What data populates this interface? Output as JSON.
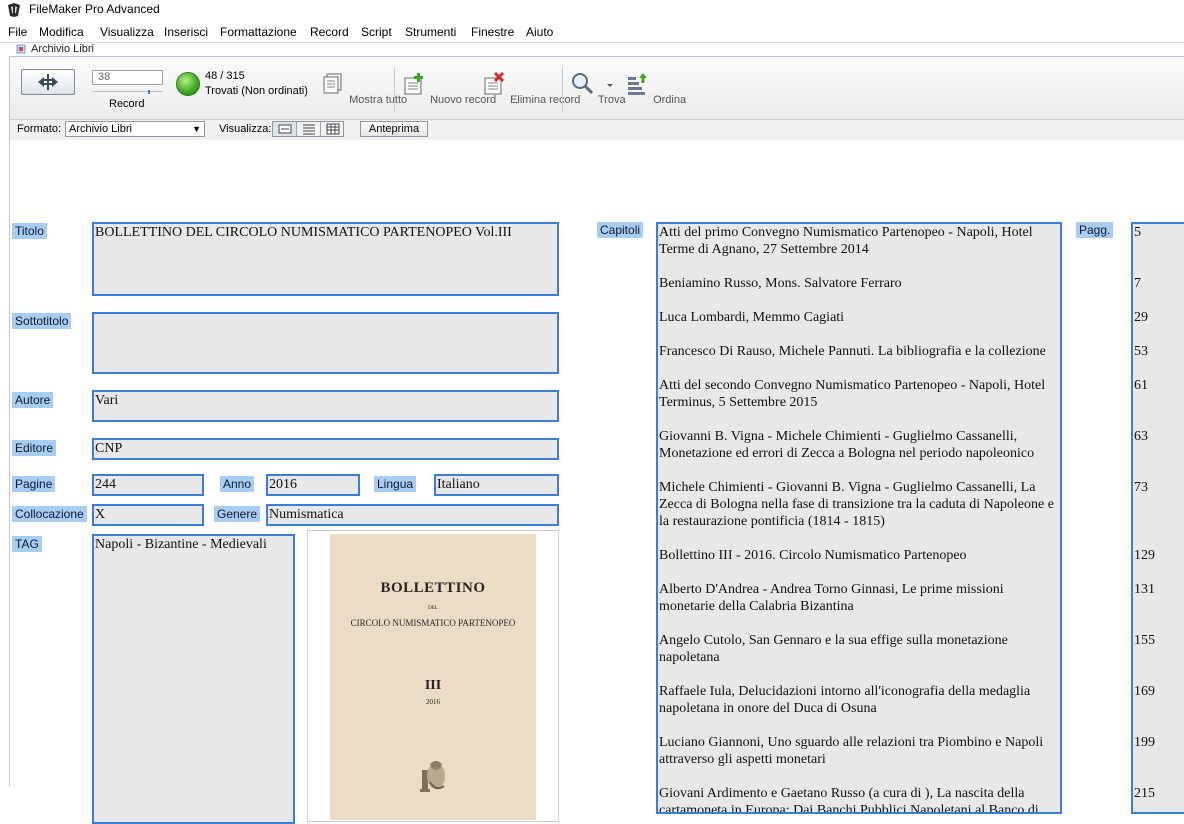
{
  "app": {
    "title": "FileMaker Pro Advanced"
  },
  "menu": [
    "File",
    "Modifica",
    "Visualizza",
    "Inserisci",
    "Formattazione",
    "Record",
    "Script",
    "Strumenti",
    "Finestre",
    "Aiuto"
  ],
  "window": {
    "title": "Archivio Libri"
  },
  "toolbar": {
    "record_number": "38",
    "record_label": "Record",
    "found_count": "48 / 315",
    "found_label": "Trovati (Non ordinati)",
    "show_all": "Mostra tutto",
    "new_record": "Nuovo record",
    "delete_record": "Elimina record",
    "find": "Trova",
    "sort": "Ordina"
  },
  "layoutbar": {
    "format_label": "Formato:",
    "format_value": "Archivio Libri",
    "view_label": "Visualizza:",
    "preview": "Anteprima"
  },
  "fields": {
    "titolo_label": "Titolo",
    "titolo": "BOLLETTINO DEL CIRCOLO NUMISMATICO PARTENOPEO   Vol.III",
    "sottotitolo_label": "Sottotitolo",
    "sottotitolo": "",
    "autore_label": "Autore",
    "autore": "Vari",
    "editore_label": "Editore",
    "editore": "CNP",
    "pagine_label": "Pagine",
    "pagine": "244",
    "anno_label": "Anno",
    "anno": "2016",
    "lingua_label": "Lingua",
    "lingua": "Italiano",
    "collocazione_label": "Collocazione",
    "collocazione": "X",
    "genere_label": "Genere",
    "genere": "Numismatica",
    "tag_label": "TAG",
    "tag": "Napoli - Bizantine - Medievali",
    "capitoli_label": "Capitoli",
    "pagg_label": "Pagg."
  },
  "cover": {
    "title": "BOLLETTINO",
    "del": "DEL",
    "circolo": "CIRCOLO NUMISMATICO PARTENOPEO",
    "volume": "III",
    "year": "2016"
  },
  "chapters": [
    {
      "text": "Atti del primo Convegno Numismatico Partenopeo - Napoli, Hotel Terme di Agnano, 27 Settembre 2014",
      "page": "5"
    },
    {
      "text": "Beniamino Russo, Mons. Salvatore Ferraro",
      "page": "7"
    },
    {
      "text": "Luca Lombardi, Memmo Cagiati",
      "page": "29"
    },
    {
      "text": "Francesco Di Rauso, Michele Pannuti. La bibliografia e la collezione",
      "page": "53"
    },
    {
      "text": "Atti del secondo Convegno Numismatico Partenopeo - Napoli, Hotel Terminus, 5 Settembre 2015",
      "page": "61"
    },
    {
      "text": "Giovanni B. Vigna - Michele Chimienti - Guglielmo Cassanelli, Monetazione ed errori di Zecca a Bologna nel periodo napoleonico",
      "page": "63"
    },
    {
      "text": "Michele Chimienti - Giovanni B. Vigna - Guglielmo Cassanelli, La Zecca di Bologna nella fase di transizione tra la caduta di Napoleone e la restaurazione pontificia (1814 - 1815)",
      "page": "73"
    },
    {
      "text": "Bollettino III - 2016. Circolo Numismatico Partenopeo",
      "page": "129"
    },
    {
      "text": "Alberto D'Andrea - Andrea Torno Ginnasi, Le prime missioni monetarie della Calabria Bizantina",
      "page": "131"
    },
    {
      "text": "Angelo Cutolo, San Gennaro e la sua effige sulla monetazione napoletana",
      "page": "155"
    },
    {
      "text": "Raffaele Iula, Delucidazioni intorno all'iconografia della medaglia napoletana in onore del Duca di Osuna",
      "page": "169"
    },
    {
      "text": "Luciano Giannoni, Uno sguardo alle relazioni tra Piombino e Napoli attraverso gli aspetti monetari",
      "page": "199"
    },
    {
      "text": "Giovani Ardimento e Gaetano Russo (a cura di ), La nascita della cartamoneta in Europa: Dai Banchi Pubblici Napoletani al Banco di",
      "page": "215"
    }
  ]
}
